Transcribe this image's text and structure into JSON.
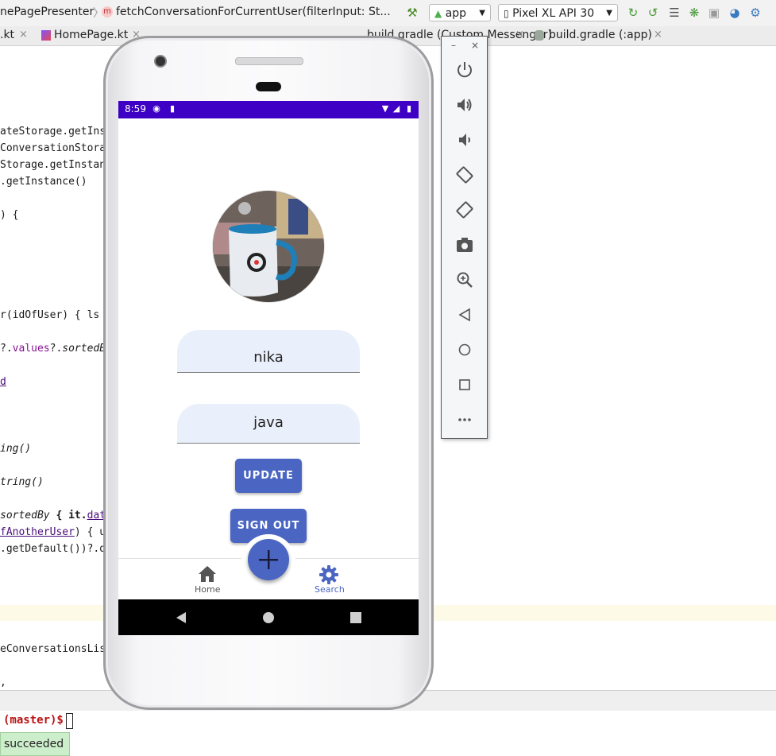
{
  "ide": {
    "breadcrumb": {
      "class_name": "nePagePresenter",
      "method_badge": "m",
      "method": "fetchConversationForCurrentUser(filterInput: St..."
    },
    "toolbar": {
      "run_config": "app",
      "device": "Pixel XL API 30",
      "icons": [
        "hammer-icon",
        "android-icon",
        "rerun-icon",
        "apply-changes-icon",
        "coverage-icon",
        "debug-icon",
        "attach-debugger-icon",
        "profiler-icon",
        "sync-icon"
      ]
    },
    "tabs": [
      {
        "label": ".kt"
      },
      {
        "label": "HomePage.kt"
      },
      {
        "label": "build.gradle (Custom Messenger)"
      },
      {
        "label": "build.gradle (:app)"
      }
    ],
    "code_lines": [
      {
        "text": "ateStorage.getIns"
      },
      {
        "text": "ConversationStora"
      },
      {
        "text": "Storage.getInstan"
      },
      {
        "text": ".getInstance()"
      },
      {
        "text": ") {"
      },
      {
        "text": "r(idOfUser) { ls "
      },
      {
        "text_a": "?.",
        "text_b": "values",
        "text_c": "?.",
        "text_d": "sortedB"
      },
      {
        "text": "d"
      },
      {
        "text": "ing()"
      },
      {
        "text": "tring()"
      },
      {
        "text_a": "sortedBy",
        "text_b": " { it.",
        "text_c": "dat"
      },
      {
        "text_a": "fAnotherUser",
        "text_b": ") { u"
      },
      {
        "text": ".getDefault())?.d"
      },
      {
        "text": "eConversationsLis"
      },
      {
        "text": ","
      }
    ],
    "terminal": {
      "prompt": "(master)$",
      "toast": "succeeded"
    }
  },
  "emulator": {
    "status_bar": {
      "time": "8:59"
    },
    "profile": {
      "username": "nika",
      "language": "java"
    },
    "buttons": {
      "update": "UPDATE",
      "sign_out": "SIGN OUT"
    },
    "bottom_nav": {
      "home": "Home",
      "search": "Search",
      "active_color": "#4a66c2",
      "inactive_color": "#555555"
    },
    "status_bar_color": "#3d00c4",
    "accent_color": "#4a66c2",
    "side_panel": {
      "minimize": "–",
      "close": "×",
      "controls": [
        "power-icon",
        "volume-up-icon",
        "volume-down-icon",
        "rotate-left-icon",
        "rotate-right-icon",
        "camera-icon",
        "zoom-icon",
        "back-icon",
        "home-icon",
        "overview-icon",
        "more-icon"
      ]
    }
  }
}
